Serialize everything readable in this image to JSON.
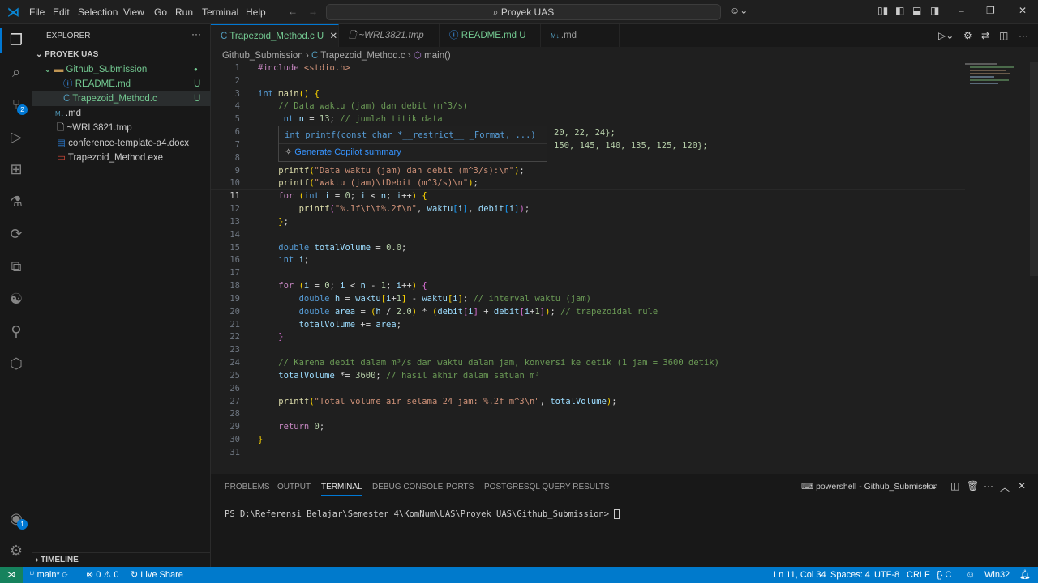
{
  "menu": [
    "File",
    "Edit",
    "Selection",
    "View",
    "Go",
    "Run",
    "Terminal",
    "Help"
  ],
  "search": "Proyek UAS",
  "source_control_badge": "2",
  "account_badge": "1",
  "explorer": {
    "title": "EXPLORER",
    "project": "PROYEK UAS",
    "folder": "Github_Submission",
    "files": [
      {
        "name": "README.md",
        "status": "U"
      },
      {
        "name": "Trapezoid_Method.c",
        "status": "U"
      }
    ],
    "root_files": [
      ".md",
      "~WRL3821.tmp",
      "conference-template-a4.docx",
      "Trapezoid_Method.exe"
    ],
    "timeline": "TIMELINE"
  },
  "tabs": [
    {
      "label": "Trapezoid_Method.c",
      "status": "U"
    },
    {
      "label": "~WRL3821.tmp"
    },
    {
      "label": "README.md",
      "status": "U"
    },
    {
      "label": ".md"
    }
  ],
  "breadcrumb": [
    "Github_Submission",
    "Trapezoid_Method.c",
    "main()"
  ],
  "code": [
    [
      [
        "#include ",
        "c"
      ],
      [
        "<stdio.h>",
        "s"
      ]
    ],
    [],
    [
      [
        "int ",
        "k"
      ],
      [
        "main",
        "f"
      ],
      [
        "() ",
        "b1"
      ],
      [
        "{",
        "b1"
      ]
    ],
    [
      [
        "    // Data waktu (jam) dan debit (m^3/s)",
        "m"
      ]
    ],
    [
      [
        "    int ",
        "k"
      ],
      [
        "n",
        "v"
      ],
      [
        " = ",
        "p"
      ],
      [
        "13",
        "n"
      ],
      [
        "; ",
        "p"
      ],
      [
        "// jumlah titik data",
        "m"
      ]
    ],
    [],
    [],
    [],
    [
      [
        "    printf",
        "f"
      ],
      [
        "(",
        "b1"
      ],
      [
        "\"Data waktu (jam) dan debit (m^3/s):\\n\"",
        "s"
      ],
      [
        ")",
        "b1"
      ],
      [
        ";",
        "p"
      ]
    ],
    [
      [
        "    printf",
        "f"
      ],
      [
        "(",
        "b1"
      ],
      [
        "\"Waktu (jam)\\tDebit (m^3/s)\\n\"",
        "s"
      ],
      [
        ")",
        "b1"
      ],
      [
        ";",
        "p"
      ]
    ],
    [
      [
        "    for ",
        "c"
      ],
      [
        "(",
        "b1"
      ],
      [
        "int ",
        "k"
      ],
      [
        "i",
        "v"
      ],
      [
        " = ",
        "p"
      ],
      [
        "0",
        "n"
      ],
      [
        "; ",
        "p"
      ],
      [
        "i",
        "v"
      ],
      [
        " < ",
        "p"
      ],
      [
        "n",
        "v"
      ],
      [
        "; ",
        "p"
      ],
      [
        "i",
        "v"
      ],
      [
        "++",
        "p"
      ],
      [
        ") ",
        "b1"
      ],
      [
        "{",
        "b1"
      ]
    ],
    [
      [
        "        printf",
        "f"
      ],
      [
        "(",
        "b2"
      ],
      [
        "\"%.1f\\t\\t%.2f\\n\"",
        "s"
      ],
      [
        ", ",
        "p"
      ],
      [
        "waktu",
        "v"
      ],
      [
        "[",
        "b3"
      ],
      [
        "i",
        "v"
      ],
      [
        "]",
        "b3"
      ],
      [
        ", ",
        "p"
      ],
      [
        "debit",
        "v"
      ],
      [
        "[",
        "b3"
      ],
      [
        "i",
        "v"
      ],
      [
        "]",
        "b3"
      ],
      [
        ")",
        "b2"
      ],
      [
        ";",
        "p"
      ]
    ],
    [
      [
        "    }",
        "b1"
      ],
      [
        ";",
        "p"
      ]
    ],
    [],
    [
      [
        "    double ",
        "k"
      ],
      [
        "totalVolume",
        "v"
      ],
      [
        " = ",
        "p"
      ],
      [
        "0.0",
        "n"
      ],
      [
        ";",
        "p"
      ]
    ],
    [
      [
        "    int ",
        "k"
      ],
      [
        "i",
        "v"
      ],
      [
        ";",
        "p"
      ]
    ],
    [],
    [
      [
        "    for ",
        "c"
      ],
      [
        "(",
        "b1"
      ],
      [
        "i",
        "v"
      ],
      [
        " = ",
        "p"
      ],
      [
        "0",
        "n"
      ],
      [
        "; ",
        "p"
      ],
      [
        "i",
        "v"
      ],
      [
        " < ",
        "p"
      ],
      [
        "n",
        "v"
      ],
      [
        " - ",
        "p"
      ],
      [
        "1",
        "n"
      ],
      [
        "; ",
        "p"
      ],
      [
        "i",
        "v"
      ],
      [
        "++",
        "p"
      ],
      [
        ") ",
        "b1"
      ],
      [
        "{",
        "b2"
      ]
    ],
    [
      [
        "        double ",
        "k"
      ],
      [
        "h",
        "v"
      ],
      [
        " = ",
        "p"
      ],
      [
        "waktu",
        "v"
      ],
      [
        "[",
        "b1"
      ],
      [
        "i",
        "v"
      ],
      [
        "+",
        "p"
      ],
      [
        "1",
        "n"
      ],
      [
        "]",
        "b1"
      ],
      [
        " - ",
        "p"
      ],
      [
        "waktu",
        "v"
      ],
      [
        "[",
        "b1"
      ],
      [
        "i",
        "v"
      ],
      [
        "]",
        "b1"
      ],
      [
        "; ",
        "p"
      ],
      [
        "// interval waktu (jam)",
        "m"
      ]
    ],
    [
      [
        "        double ",
        "k"
      ],
      [
        "area",
        "v"
      ],
      [
        " = ",
        "p"
      ],
      [
        "(",
        "b1"
      ],
      [
        "h",
        "v"
      ],
      [
        " / ",
        "p"
      ],
      [
        "2.0",
        "n"
      ],
      [
        ")",
        "b1"
      ],
      [
        " * ",
        "p"
      ],
      [
        "(",
        "b1"
      ],
      [
        "debit",
        "v"
      ],
      [
        "[",
        "b2"
      ],
      [
        "i",
        "v"
      ],
      [
        "]",
        "b2"
      ],
      [
        " + ",
        "p"
      ],
      [
        "debit",
        "v"
      ],
      [
        "[",
        "b2"
      ],
      [
        "i",
        "v"
      ],
      [
        "+",
        "p"
      ],
      [
        "1",
        "n"
      ],
      [
        "]",
        "b2"
      ],
      [
        ")",
        "b1"
      ],
      [
        "; ",
        "p"
      ],
      [
        "// trapezoidal rule",
        "m"
      ]
    ],
    [
      [
        "        totalVolume",
        "v"
      ],
      [
        " += ",
        "p"
      ],
      [
        "area",
        "v"
      ],
      [
        ";",
        "p"
      ]
    ],
    [
      [
        "    }",
        "b2"
      ]
    ],
    [],
    [
      [
        "    // Karena debit dalam m³/s dan waktu dalam jam, konversi ke detik (1 jam = 3600 detik)",
        "m"
      ]
    ],
    [
      [
        "    totalVolume",
        "v"
      ],
      [
        " *= ",
        "p"
      ],
      [
        "3600",
        "n"
      ],
      [
        "; ",
        "p"
      ],
      [
        "// hasil akhir dalam satuan m³",
        "m"
      ]
    ],
    [],
    [
      [
        "    printf",
        "f"
      ],
      [
        "(",
        "b1"
      ],
      [
        "\"Total volume air selama 24 jam: %.2f m^3\\n\"",
        "s"
      ],
      [
        ", ",
        "p"
      ],
      [
        "totalVolume",
        "v"
      ],
      [
        ")",
        "b1"
      ],
      [
        ";",
        "p"
      ]
    ],
    [],
    [
      [
        "    return ",
        "c"
      ],
      [
        "0",
        "n"
      ],
      [
        ";",
        "p"
      ]
    ],
    [
      [
        "}",
        "b1"
      ]
    ],
    []
  ],
  "partial_lines": {
    "line6": "20, 22, 24};",
    "line7": "150, 145, 140, 135, 125, 120};"
  },
  "hover": {
    "signature": "int printf(const char *__restrict__ _Format, ...)",
    "action": "Generate Copilot summary"
  },
  "panel": {
    "tabs": [
      "PROBLEMS",
      "OUTPUT",
      "TERMINAL",
      "DEBUG CONSOLE",
      "PORTS",
      "POSTGRESQL QUERY RESULTS"
    ],
    "active": "TERMINAL",
    "terminal_name": "powershell - Github_Submission",
    "prompt": "PS D:\\Referensi Belajar\\Semester 4\\KomNum\\UAS\\Proyek UAS\\Github_Submission> "
  },
  "status": {
    "branch": "main*",
    "errors": "0",
    "warnings": "0",
    "live_share": "Live Share",
    "position": "Ln 11, Col 34",
    "spaces": "Spaces: 4",
    "encoding": "UTF-8",
    "eol": "CRLF",
    "language": "C",
    "platform": "Win32"
  },
  "colors": {
    "accent": "#007acc",
    "keyword": "#569cd6",
    "string": "#ce9178",
    "comment": "#6a9955"
  }
}
